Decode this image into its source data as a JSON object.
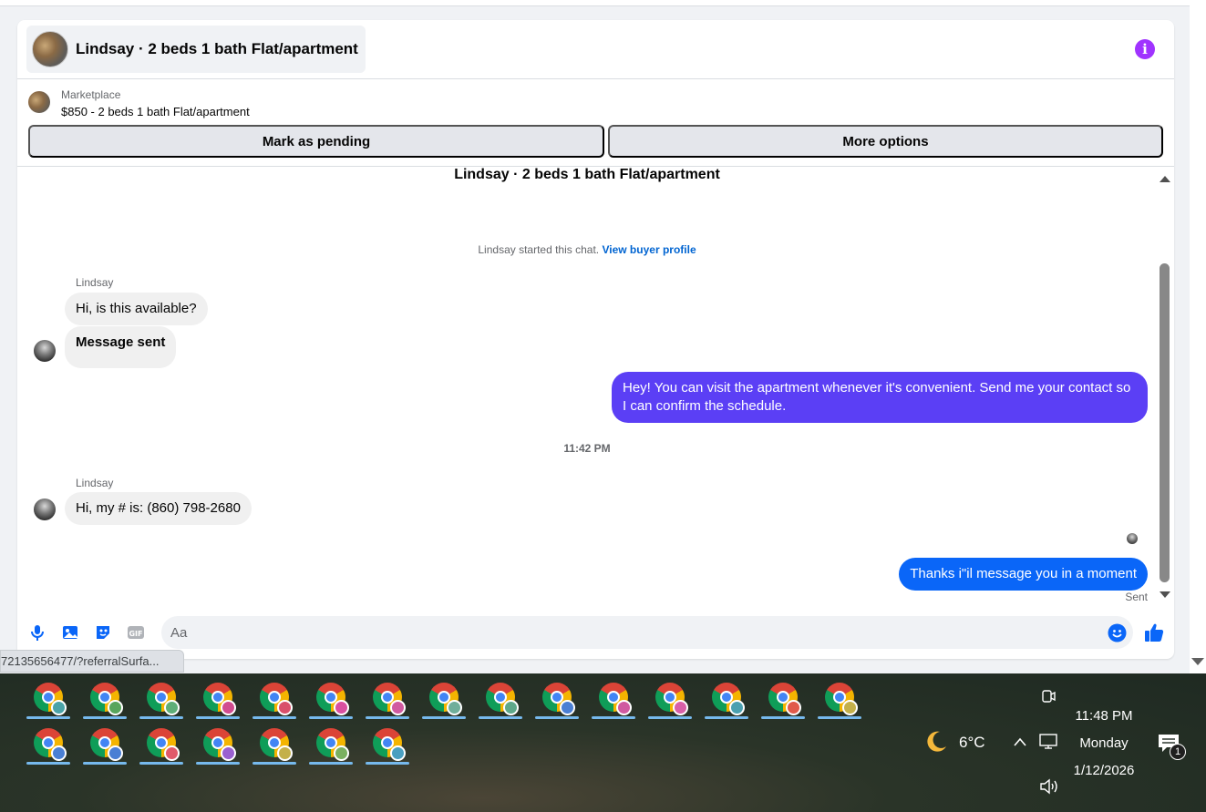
{
  "header": {
    "title": "Lindsay · 2 beds 1 bath Flat/apartment",
    "info_icon": "info-icon"
  },
  "listing": {
    "source": "Marketplace",
    "price_title": "$850 - 2 beds 1 bath Flat/apartment"
  },
  "actions": {
    "mark_pending": "Mark as pending",
    "more_options": "More options"
  },
  "conversation": {
    "title": "Lindsay · 2 beds 1 bath Flat/apartment",
    "started_note": "Lindsay started this chat.",
    "view_profile_link": "View buyer profile",
    "messages": [
      {
        "sender": "Lindsay",
        "text": "Hi, is this available?",
        "direction": "in"
      },
      {
        "text": "Message sent",
        "direction": "in"
      },
      {
        "text": "Hey! You can visit the apartment whenever it's convenient. Send me your contact so I can confirm the schedule.",
        "direction": "out"
      },
      {
        "timestamp": "11:42 PM"
      },
      {
        "sender": "Lindsay",
        "text": "Hi, my # is: (860) 798-2680",
        "direction": "in"
      },
      {
        "text": "Thanks i\"il message you in a moment",
        "direction": "out"
      }
    ],
    "status": "Sent"
  },
  "composer": {
    "placeholder": "Aa",
    "icons": [
      "microphone-icon",
      "image-icon",
      "sticker-icon",
      "gif-icon",
      "emoji-icon",
      "thumbs-up-icon"
    ]
  },
  "status_bar": {
    "url": "7213565647​7/?referralSurfa..."
  },
  "taskbar": {
    "weather_temp": "6°C",
    "time": "11:48 PM",
    "day": "Monday",
    "date": "1/12/2026",
    "notification_count": "1",
    "row1_badges": [
      "#4aa3a8",
      "#58a55c",
      "#5eae78",
      "#d14b8f",
      "#d94f6a",
      "#d94fa0",
      "#d05aa0",
      "#6fae9a",
      "#5ea88a",
      "#4a7fd4",
      "#d05aa0",
      "#d85fa8",
      "#4aa0b0",
      "#e05a4a",
      "#c4b04a"
    ],
    "row2_badges": [
      "#4a7fd4",
      "#4a7fd4",
      "#e05a6a",
      "#9a60d0",
      "#c4b04a",
      "#7ab060",
      "#4a9fc0"
    ],
    "colors": {
      "accent_purple": "#5b3ff5",
      "accent_blue": "#0a66f8",
      "link_blue": "#0064d1",
      "info_purple": "#a033ff"
    }
  }
}
